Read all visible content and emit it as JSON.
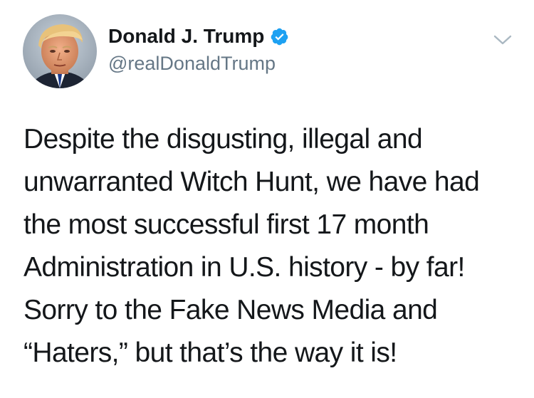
{
  "tweet": {
    "author": {
      "display_name": "Donald J. Trump",
      "handle": "@realDonaldTrump",
      "verified": true,
      "avatar_icon": "profile-photo-avatar"
    },
    "menu_icon": "chevron-down-icon",
    "text": "Despite the disgusting, illegal and\nunwarranted Witch Hunt, we have had\nthe most successful first 17 month\nAdministration in U.S. history - by far!\nSorry to the Fake News Media and\n“Haters,” but that’s the way it is!"
  },
  "colors": {
    "text_primary": "#14171a",
    "text_secondary": "#657786",
    "verified_blue": "#1da1f2",
    "caret_gray": "#aab8c2"
  }
}
